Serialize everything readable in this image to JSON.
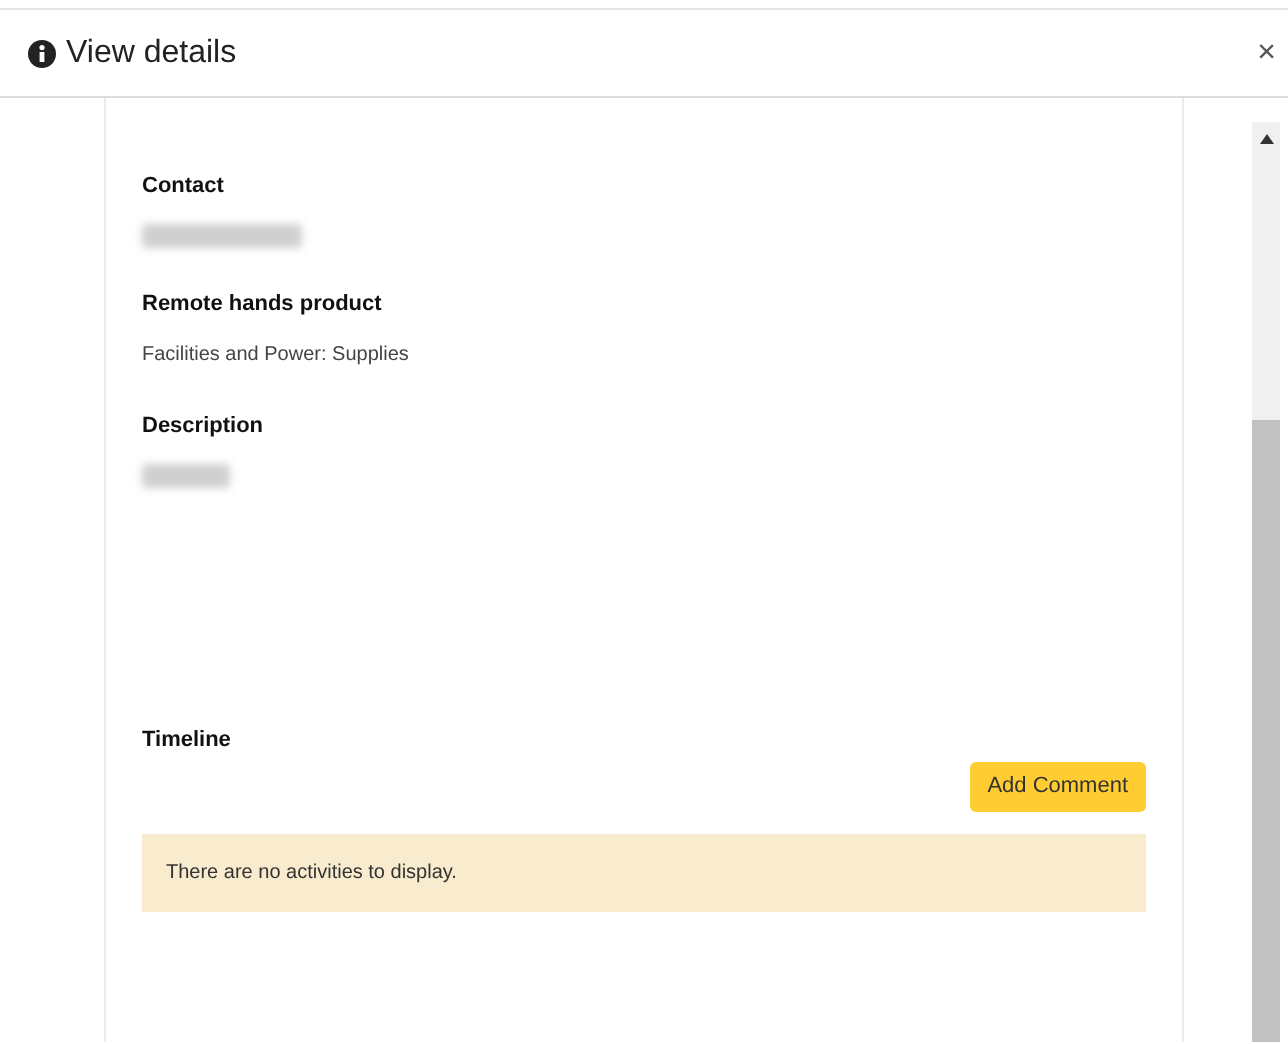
{
  "dialog": {
    "title": "View details",
    "close": "×"
  },
  "fields": [
    {
      "label": "Contact",
      "kind": "redacted"
    },
    {
      "label": "Remote hands product",
      "kind": "text",
      "value": "Facilities and Power: Supplies"
    },
    {
      "label": "Description",
      "kind": "redacted"
    }
  ],
  "timeline": {
    "label": "Timeline",
    "button": "Add Comment",
    "empty_message": "There are no activities to display."
  }
}
